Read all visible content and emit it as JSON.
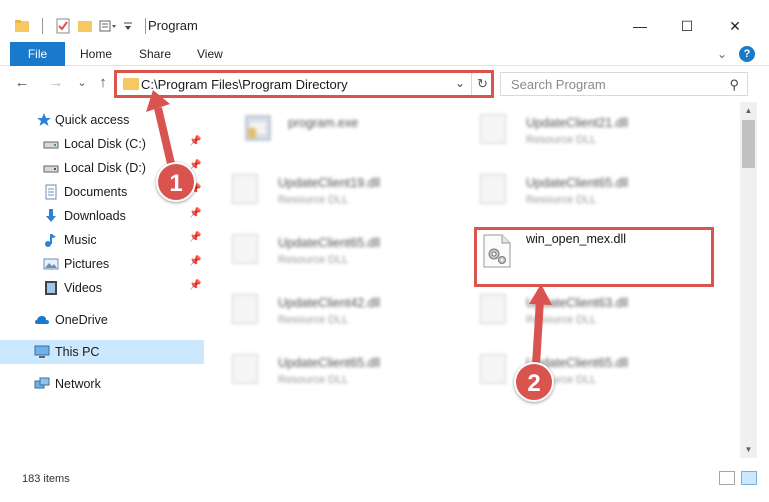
{
  "window": {
    "title": "Program",
    "minimize": "—",
    "maximize": "☐",
    "close": "✕"
  },
  "ribbon": {
    "tabs": [
      "File",
      "Home",
      "Share",
      "View"
    ],
    "expand": "⌄",
    "help": "?"
  },
  "nav": {
    "back": "←",
    "forward": "→",
    "recent": "⌄",
    "up": "↑",
    "address": "C:\\Program Files\\Program Directory",
    "address_chevron": "⌄",
    "refresh": "↻",
    "search_placeholder": "Search Program",
    "search_icon": "⚲"
  },
  "sidebar": {
    "items": [
      {
        "label": "Quick access",
        "icon": "star-icon",
        "pinned": false
      },
      {
        "label": "Local Disk (C:)",
        "icon": "drive-icon",
        "pinned": true
      },
      {
        "label": "Local Disk (D:)",
        "icon": "drive-icon",
        "pinned": true
      },
      {
        "label": "Documents",
        "icon": "documents-icon",
        "pinned": true
      },
      {
        "label": "Downloads",
        "icon": "downloads-icon",
        "pinned": true
      },
      {
        "label": "Music",
        "icon": "music-icon",
        "pinned": true
      },
      {
        "label": "Pictures",
        "icon": "pictures-icon",
        "pinned": true
      },
      {
        "label": "Videos",
        "icon": "videos-icon",
        "pinned": true
      },
      {
        "label": "OneDrive",
        "icon": "cloud-icon",
        "pinned": false
      },
      {
        "label": "This PC",
        "icon": "computer-icon",
        "pinned": false
      },
      {
        "label": "Network",
        "icon": "network-icon",
        "pinned": false
      }
    ],
    "pin_glyph": "📌"
  },
  "files": [
    {
      "name": "program.exe",
      "type": ""
    },
    {
      "name": "UpdateClient21.dll",
      "type": "Resource DLL"
    },
    {
      "name": "UpdateClient19.dll",
      "type": "Resource DLL"
    },
    {
      "name": "UpdateClient65.dll",
      "type": "Resource DLL"
    },
    {
      "name": "UpdateClient65.dll",
      "type": "Resource DLL"
    },
    {
      "name": "win_open_mex.dll",
      "type": ""
    },
    {
      "name": "UpdateClient42.dll",
      "type": "Resource DLL"
    },
    {
      "name": "UpdateClient63.dll",
      "type": "Resource DLL"
    },
    {
      "name": "UpdateClient65.dll",
      "type": "Resource DLL"
    },
    {
      "name": "UpdateClient65.dll",
      "type": "Resource DLL"
    }
  ],
  "status": {
    "item_count": "183 items"
  },
  "annotations": {
    "step1": "1",
    "step2": "2"
  },
  "colors": {
    "accent": "#1979ca",
    "annotation_red": "#d9534f",
    "selected_bg": "#cce8ff"
  }
}
